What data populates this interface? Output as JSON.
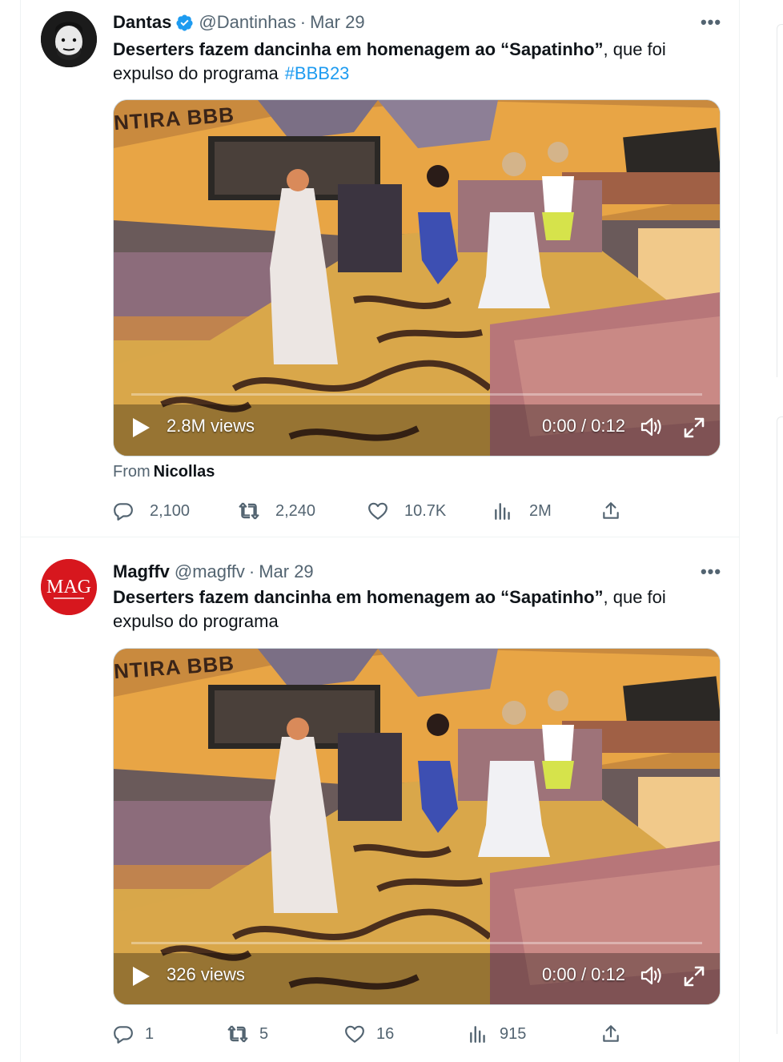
{
  "tweets": [
    {
      "author_name": "Dantas",
      "verified": true,
      "handle": "@Dantinhas",
      "separator": "·",
      "date": "Mar 29",
      "text_bold": "Deserters fazem dancinha em homenagem ao “Sapatinho”",
      "text_rest": ", que foi expulso do programa",
      "hashtag": "#BBB23",
      "video": {
        "overlay_logo": "NTIRA BBB",
        "views": "2.8M views",
        "time": "0:00 / 0:12"
      },
      "from_label": "From",
      "from_name": "Nicollas",
      "replies": "2,100",
      "reposts": "2,240",
      "likes": "10.7K",
      "view_count": "2M"
    },
    {
      "author_name": "Magffv",
      "verified": false,
      "handle": "@magffv",
      "separator": "·",
      "date": "Mar 29",
      "avatar_text": "MAG",
      "text_bold": "Deserters fazem dancinha em homenagem ao “Sapatinho”",
      "text_rest": ", que foi expulso do programa",
      "video": {
        "overlay_logo": "NTIRA BBB",
        "views": "326 views",
        "time": "0:00 / 0:12"
      },
      "replies": "1",
      "reposts": "5",
      "likes": "16",
      "view_count": "915"
    }
  ],
  "colors": {
    "accent": "#1d9bf0",
    "text": "#0f1419",
    "secondary": "#536471",
    "mag_red": "#d7171e"
  },
  "icons": [
    "verified-badge-icon",
    "more-icon",
    "play-icon",
    "volume-icon",
    "fullscreen-icon",
    "reply-icon",
    "repost-icon",
    "like-icon",
    "analytics-icon",
    "share-icon"
  ]
}
